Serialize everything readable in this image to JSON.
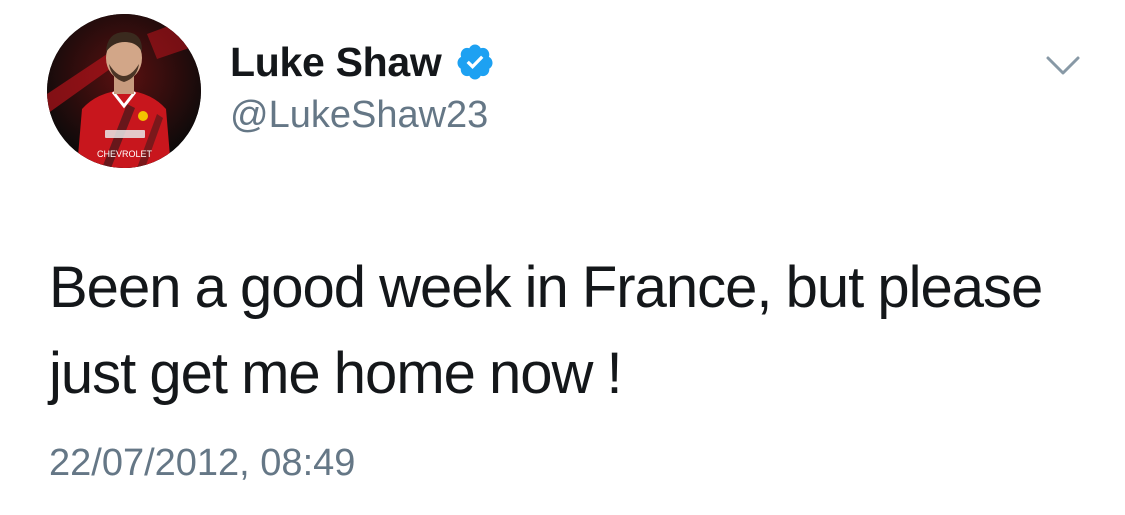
{
  "tweet": {
    "author": {
      "display_name": "Luke Shaw",
      "handle": "@LukeShaw23",
      "verified": true,
      "avatar_sponsor_text": "CHEVROLET"
    },
    "text": "Been a good week in France, but please just get me home now !",
    "timestamp": "22/07/2012, 08:49"
  },
  "icons": {
    "verified": "verified-badge-icon",
    "menu": "chevron-down-icon"
  },
  "colors": {
    "verified": "#1da1f2",
    "secondary_text": "#657786",
    "primary_text": "#14171a"
  }
}
